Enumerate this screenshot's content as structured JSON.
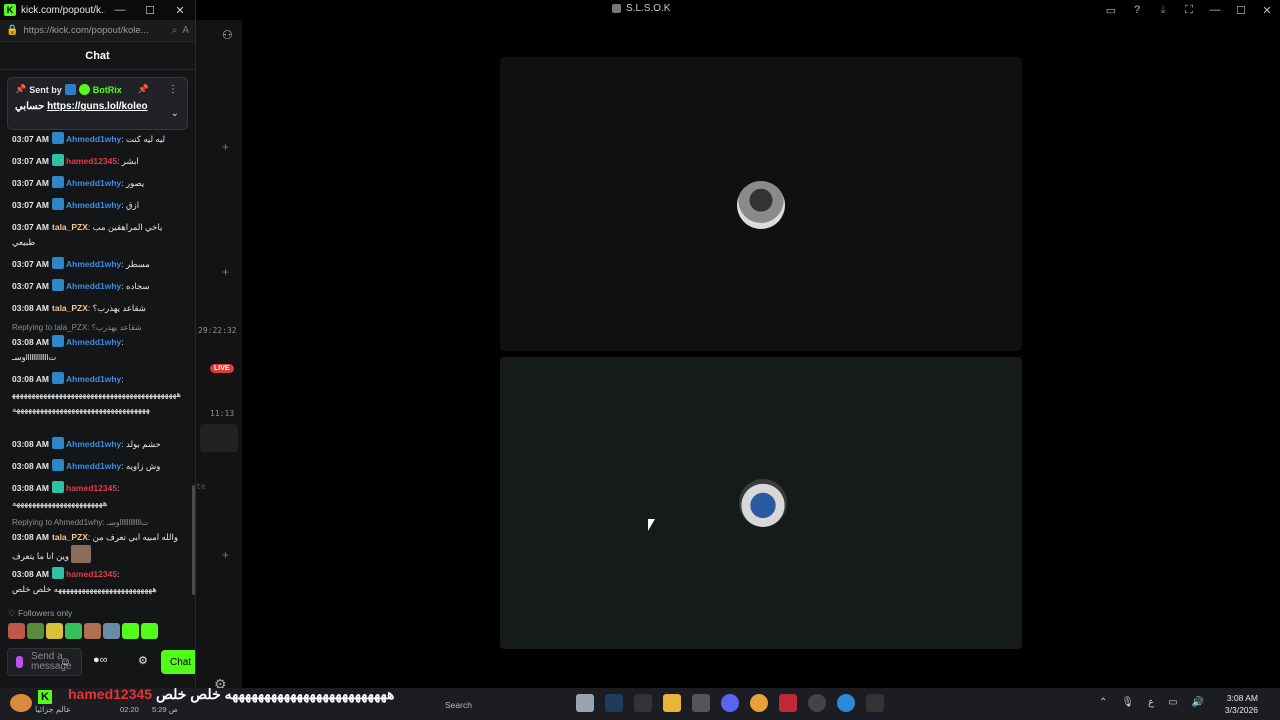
{
  "chat_window": {
    "title": "kick.com/popout/k...",
    "url": "https://kick.com/popout/kole...",
    "header": "Chat",
    "pinned": {
      "sent_by_label": "Sent by",
      "bot_name": "BotRix",
      "message_prefix": "حسابي",
      "link": "https://guns.lol/koleo"
    },
    "messages": [
      {
        "time": "03:07 AM",
        "user": "Ahmedd1why",
        "color": "blue",
        "badge": "bot",
        "text": "ليه ليه كنت"
      },
      {
        "time": "03:07 AM",
        "user": "hamed12345",
        "color": "red",
        "badge": "sub",
        "text": "ابشر"
      },
      {
        "time": "03:07 AM",
        "user": "Ahmedd1why",
        "color": "blue",
        "badge": "bot",
        "text": "يصور"
      },
      {
        "time": "03:07 AM",
        "user": "Ahmedd1why",
        "color": "blue",
        "badge": "bot",
        "text": "ازق"
      },
      {
        "time": "03:07 AM",
        "user": "tala_PZX",
        "color": "tan",
        "badge": "",
        "text": "ياخي المراهقين مب طبيعي"
      },
      {
        "time": "03:07 AM",
        "user": "Ahmedd1why",
        "color": "blue",
        "badge": "bot",
        "text": "مسطر"
      },
      {
        "time": "03:07 AM",
        "user": "Ahmedd1why",
        "color": "blue",
        "badge": "bot",
        "text": "سجاده"
      },
      {
        "time": "03:08 AM",
        "user": "tala_PZX",
        "color": "tan",
        "badge": "",
        "text": "شقاعد يهذرب؟"
      },
      {
        "time": "03:08 AM",
        "user": "Ahmedd1why",
        "color": "blue",
        "badge": "bot",
        "text": "وسـllllllllllllت",
        "reply": "Replying to tala_PZX: شقاعد يهذرب؟"
      },
      {
        "time": "03:08 AM",
        "user": "Ahmedd1why",
        "color": "blue",
        "badge": "bot",
        "text": "هههههههههههههههههههههههههههههههههههههههههههههههههههههههههههههههههههههههههههههه"
      },
      {
        "time": "03:08 AM",
        "user": "Ahmedd1why",
        "color": "blue",
        "badge": "bot",
        "text": "حشم بولد"
      },
      {
        "time": "03:08 AM",
        "user": "Ahmedd1why",
        "color": "blue",
        "badge": "bot",
        "text": "وش زاويه"
      },
      {
        "time": "03:08 AM",
        "user": "hamed12345",
        "color": "red",
        "badge": "sub",
        "text": "هههههههههههههههههههههههه"
      },
      {
        "time": "03:08 AM",
        "user": "tala_PZX",
        "color": "tan",
        "badge": "",
        "text": "والله امبيه ابي تعرف من وين انا ما يتعرف",
        "reply": "Replying to Ahmedd1why: وسـllllllllllllت"
      },
      {
        "time": "03:08 AM",
        "user": "hamed12345",
        "color": "red",
        "badge": "sub",
        "text": "هههههههههههههههههههههههههه خلص خلص"
      }
    ],
    "followers_only": "Followers only",
    "input_placeholder": "Send a message",
    "chat_button": "Chat"
  },
  "app": {
    "title": "S.L.S.O.K",
    "side_times": [
      "29:22:32",
      "11:13"
    ],
    "live_badge": "LIVE",
    "side_hint": "te"
  },
  "taskbar": {
    "overlay_user": "hamed12345",
    "overlay_text": "هههههههههههههههههههههههههه خلص خلص",
    "weather_text": "عالم جزائيا",
    "small_1": "02:20",
    "small_2": "ص 5:29",
    "search": "Search",
    "lang": "ع",
    "time": "3:08 AM",
    "date": "3/3/2026"
  }
}
